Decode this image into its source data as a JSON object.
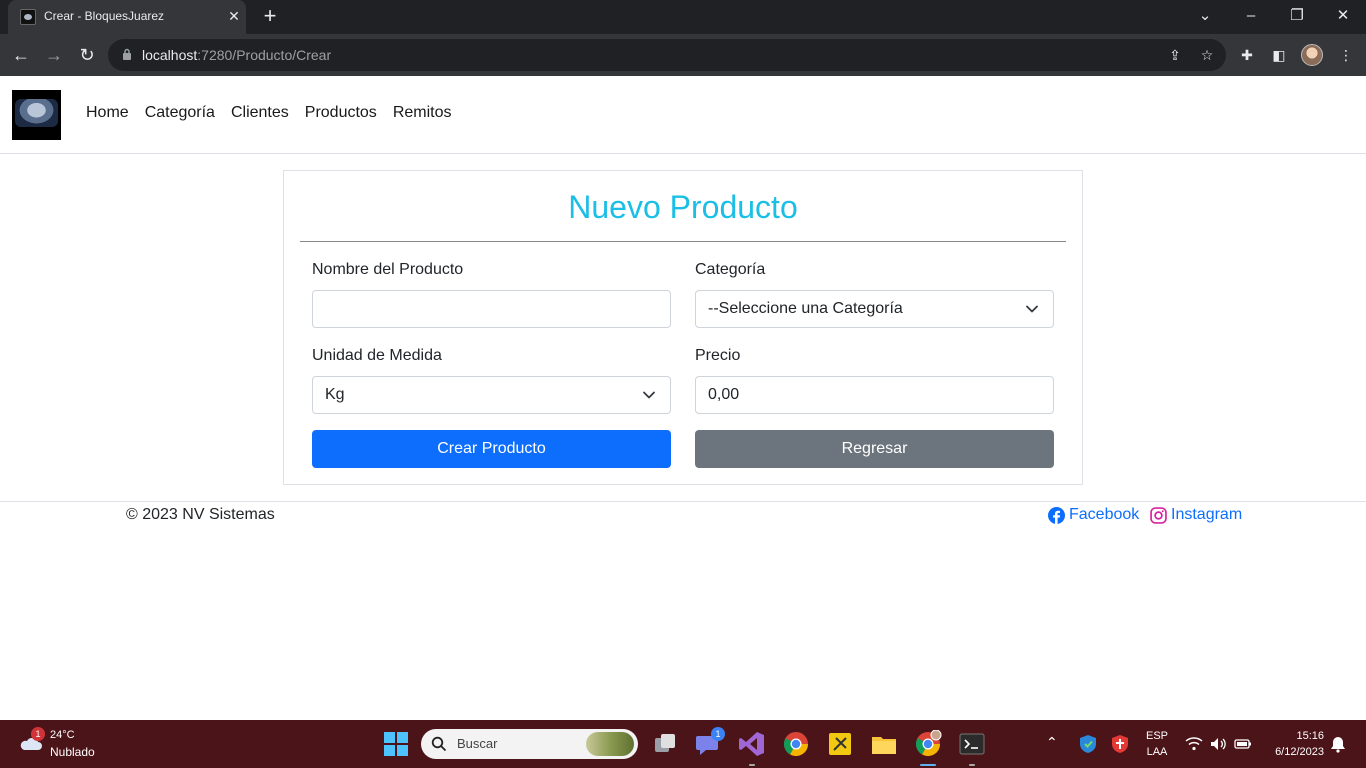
{
  "browser": {
    "tab_title": "Crear - BloquesJuarez",
    "url_host": "localhost",
    "url_path": ":7280/Producto/Crear"
  },
  "navbar": {
    "links": [
      "Home",
      "Categoría",
      "Clientes",
      "Productos",
      "Remitos"
    ]
  },
  "form": {
    "title": "Nuevo Producto",
    "nombre_label": "Nombre del Producto",
    "nombre_value": "",
    "categoria_label": "Categoría",
    "categoria_selected": "--Seleccione una Categoría",
    "unidad_label": "Unidad de Medida",
    "unidad_selected": "Kg",
    "precio_label": "Precio",
    "precio_value": "0,00",
    "crear_label": "Crear Producto",
    "regresar_label": "Regresar"
  },
  "footer": {
    "copyright": "© 2023 NV Sistemas",
    "facebook": "Facebook",
    "instagram": "Instagram"
  },
  "taskbar": {
    "weather_badge": "1",
    "temperature": "24°C",
    "weather": "Nublado",
    "search_placeholder": "Buscar",
    "teams_badge": "1",
    "lang_top": "ESP",
    "lang_bottom": "LAA",
    "time": "15:16",
    "date": "6/12/2023"
  },
  "colors": {
    "title_accent": "#1bbfe6",
    "primary": "#0d6efd",
    "secondary": "#6c757d",
    "taskbar": "#4b1419"
  }
}
